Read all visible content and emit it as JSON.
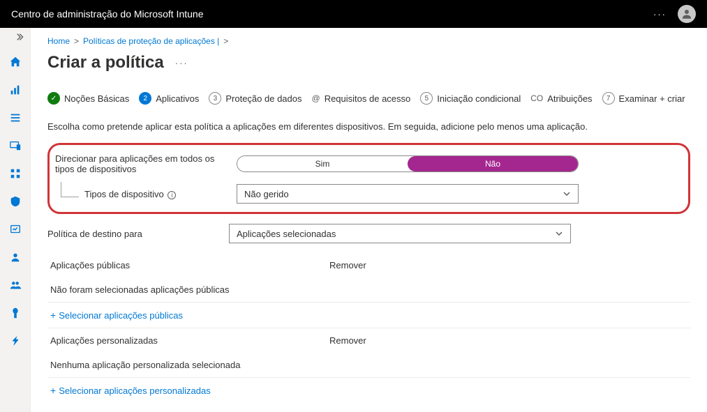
{
  "topbar": {
    "title": "Centro de administração do Microsoft Intune"
  },
  "breadcrumbs": {
    "home": "Home",
    "sep": ">",
    "level1": "Políticas de proteção de aplicações |",
    "sep2": ">"
  },
  "page": {
    "title": "Criar a política"
  },
  "wizard": {
    "s1": "Noções Básicas",
    "s2": "Aplicativos",
    "s3_num": "3",
    "s3": "Proteção de dados",
    "s4_pre": "@",
    "s4": "Requisitos de acesso",
    "s5_num": "5",
    "s5": "Iniciação condicional",
    "s6_pre": "CO",
    "s6": "Atribuições",
    "s7_num": "7",
    "s7": "Examinar + criar"
  },
  "intro": "Escolha como pretende aplicar esta política a aplicações em diferentes dispositivos. Em seguida, adicione pelo menos uma aplicação.",
  "form": {
    "target_label": "Direcionar para aplicações em todos os tipos de dispositivos",
    "yes": "Sim",
    "no": "Não",
    "device_types_label": "Tipos de dispositivo",
    "device_types_value": "Não gerido",
    "dest_label": "Política de destino para",
    "dest_value": "Aplicações selecionadas"
  },
  "sections": {
    "public_head": "Aplicações públicas",
    "remove": "Remover",
    "public_empty": "Não foram selecionadas aplicações públicas",
    "public_add": "Selecionar aplicações públicas",
    "custom_head": "Aplicações personalizadas",
    "custom_empty": "Nenhuma aplicação personalizada selecionada",
    "custom_add": "Selecionar aplicações personalizadas"
  }
}
